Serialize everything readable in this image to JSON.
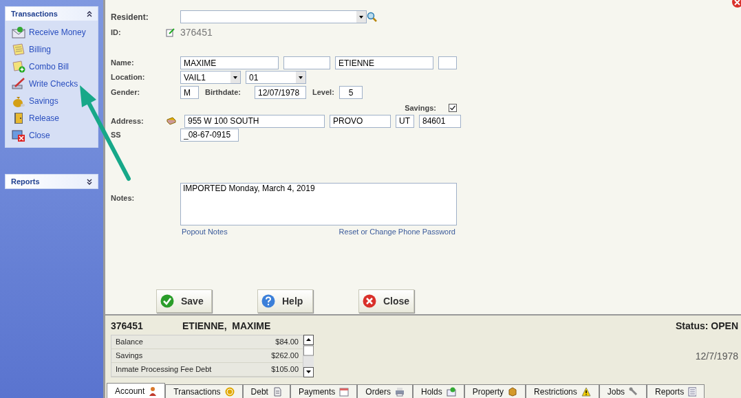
{
  "sidebar": {
    "groups": [
      {
        "title": "Transactions",
        "expanded": true,
        "items": [
          "Receive Money",
          "Billing",
          "Combo Bill",
          "Write Checks",
          "Savings",
          "Release",
          "Close"
        ]
      },
      {
        "title": "Reports",
        "expanded": false
      }
    ]
  },
  "form": {
    "resident": {
      "label": "Resident:"
    },
    "id": {
      "label": "ID:",
      "value": "376451"
    },
    "name": {
      "label": "Name:",
      "first": "MAXIME",
      "last": "ETIENNE"
    },
    "location": {
      "label": "Location:",
      "site": "VAIL1",
      "unit": "01"
    },
    "gender": {
      "label": "Gender:",
      "value": "M"
    },
    "birthdate": {
      "label": "Birthdate:",
      "value": "12/07/1978"
    },
    "level": {
      "label": "Level:",
      "value": "5"
    },
    "savings": {
      "label": "Savings:",
      "checked": true
    },
    "address": {
      "label": "Address:",
      "street": "955 W 100 SOUTH",
      "city": "PROVO",
      "state": "UT",
      "zip": "84601"
    },
    "ssn": {
      "label": "SS",
      "value": "_08-67-0915"
    },
    "notes": {
      "label": "Notes:",
      "value": "IMPORTED Monday, March 4, 2019"
    },
    "links": [
      "Popout Notes",
      "Reset or Change Phone Password"
    ]
  },
  "buttons": [
    "Save",
    "Help",
    "Close"
  ],
  "summary": {
    "id": "376451",
    "name": "ETIENNE,  MAXIME",
    "status": "Status: OPEN",
    "date": "12/7/1978",
    "rows": [
      {
        "label": "Balance",
        "amount": "$84.00"
      },
      {
        "label": "Savings",
        "amount": "$262.00"
      },
      {
        "label": "Inmate Processing Fee Debt",
        "amount": "$105.00"
      }
    ]
  },
  "tabs": [
    {
      "label": "Account",
      "selected": true
    },
    {
      "label": "Transactions",
      "selected": false
    },
    {
      "label": "Debt",
      "selected": false
    },
    {
      "label": "Payments",
      "selected": false
    },
    {
      "label": "Orders",
      "selected": false
    },
    {
      "label": "Holds",
      "selected": false
    },
    {
      "label": "Property",
      "selected": false
    },
    {
      "label": "Restrictions",
      "selected": false
    },
    {
      "label": "Jobs",
      "selected": false
    },
    {
      "label": "Reports",
      "selected": false
    }
  ]
}
